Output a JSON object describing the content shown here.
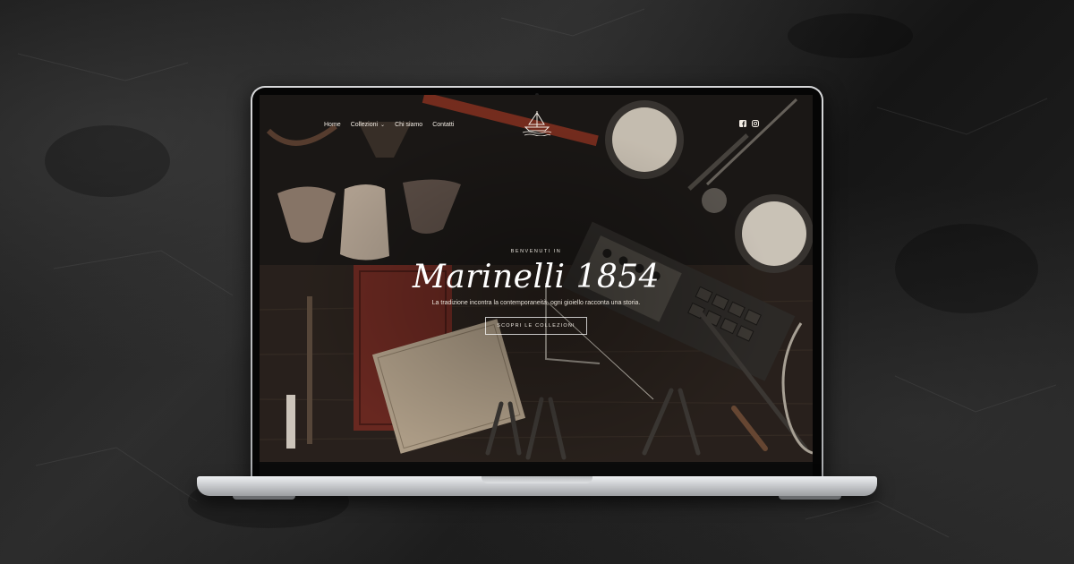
{
  "site": {
    "nav": [
      {
        "label": "Home"
      },
      {
        "label": "Collezioni"
      },
      {
        "label": "Chi siamo"
      },
      {
        "label": "Contatti"
      }
    ],
    "social": [
      "facebook-icon",
      "instagram-icon"
    ]
  },
  "hero": {
    "eyebrow": "BENVENUTI IN",
    "title": "Marinelli 1854",
    "tagline": "La tradizione incontra la contemporaneità, ogni gioiello racconta una storia.",
    "cta_label": "SCOPRI LE COLLEZIONI"
  },
  "colors": {
    "accent_text": "#f4efe8",
    "background": "#141211"
  }
}
